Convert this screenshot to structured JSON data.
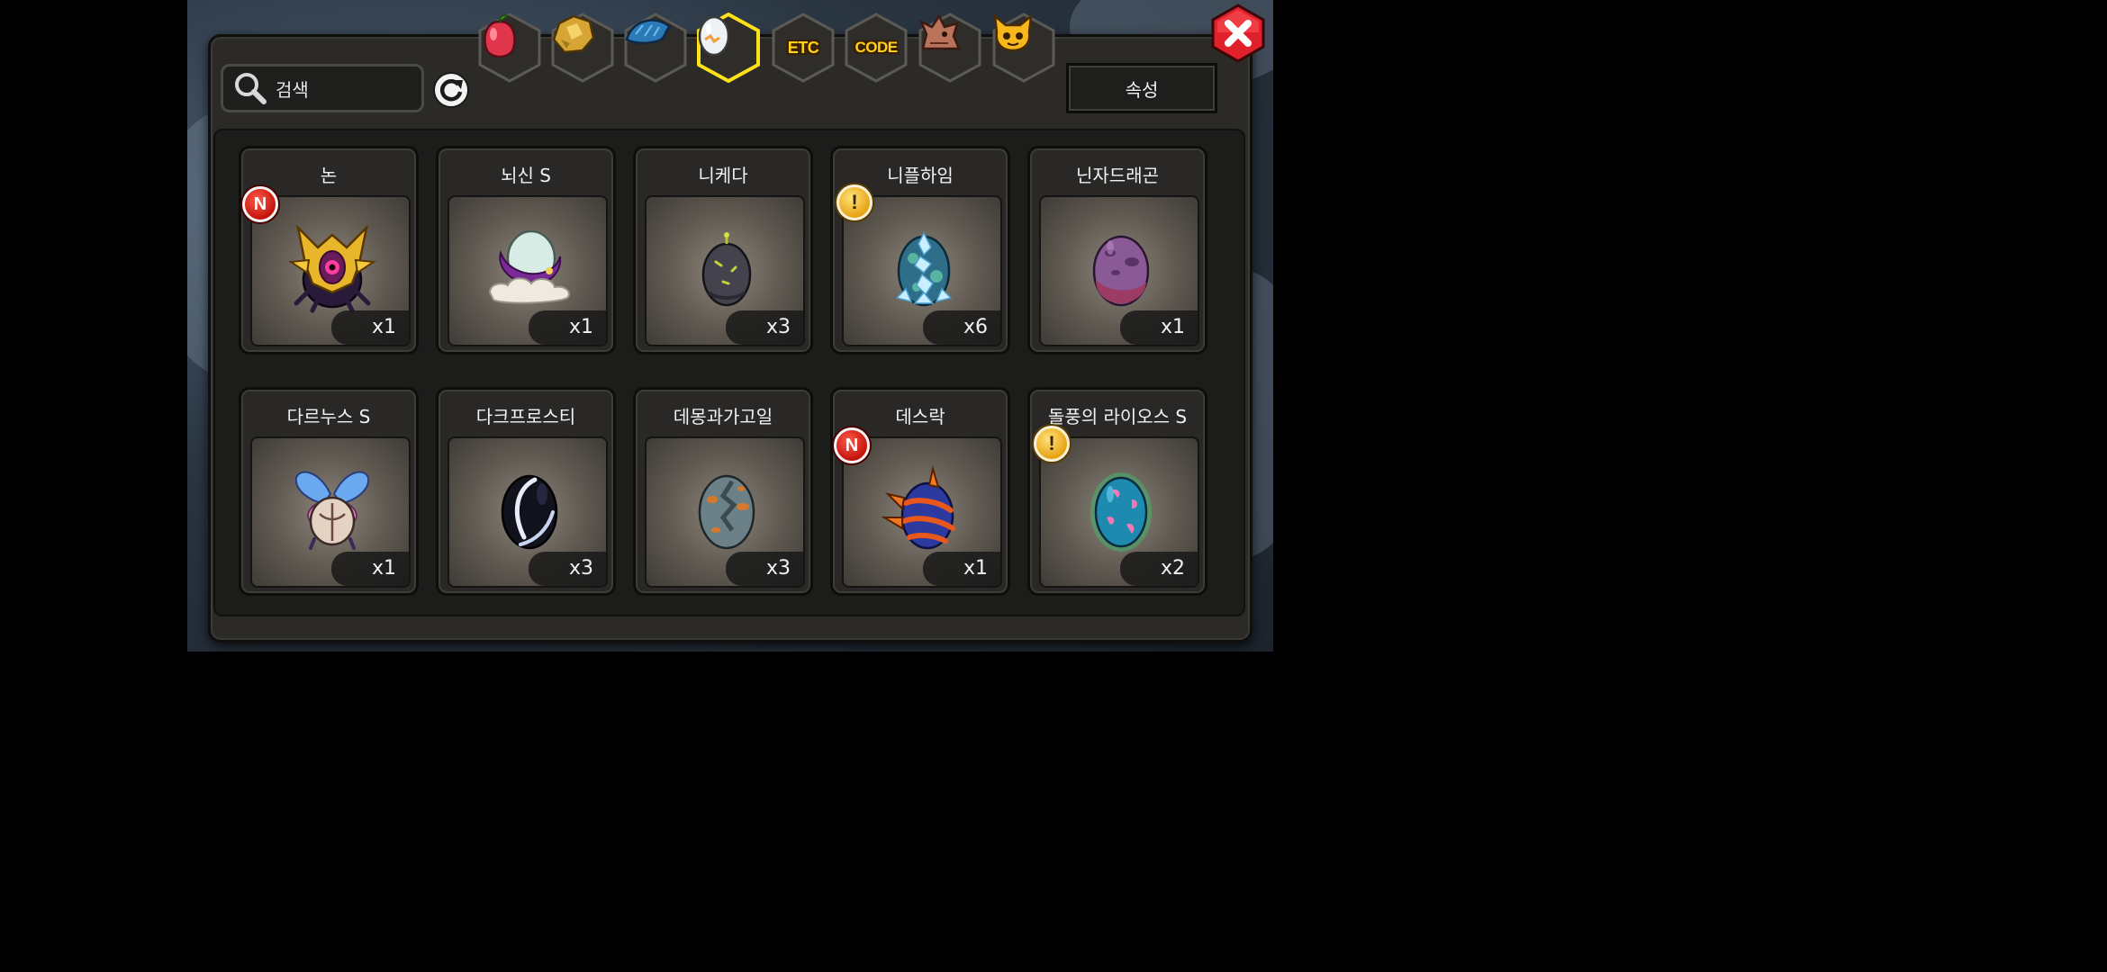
{
  "tabs": [
    {
      "name": "fruit",
      "icon": "red-fruit-icon",
      "label": ""
    },
    {
      "name": "gold",
      "icon": "gold-ore-icon",
      "label": ""
    },
    {
      "name": "wing",
      "icon": "blue-wing-icon",
      "label": ""
    },
    {
      "name": "egg",
      "icon": "egg-icon",
      "label": "",
      "selected": true
    },
    {
      "name": "etc",
      "icon": "text-tab",
      "label": "ETC"
    },
    {
      "name": "code",
      "icon": "text-tab",
      "label": "CODE"
    },
    {
      "name": "dragon",
      "icon": "dragon-head-icon",
      "label": ""
    },
    {
      "name": "mascot",
      "icon": "yellow-mascot-icon",
      "label": ""
    }
  ],
  "search": {
    "label": "검색"
  },
  "attribute_button": {
    "label": "속성"
  },
  "items": [
    {
      "name": "논",
      "count": "x1",
      "badge": "N",
      "egg": "gold-horned-egg"
    },
    {
      "name": "뇌신 S",
      "count": "x1",
      "badge": "",
      "egg": "cloud-egg"
    },
    {
      "name": "니케다",
      "count": "x3",
      "badge": "",
      "egg": "dark-gray-egg"
    },
    {
      "name": "니플하임",
      "count": "x6",
      "badge": "!",
      "egg": "ice-crystal-egg"
    },
    {
      "name": "닌자드래곤",
      "count": "x1",
      "badge": "",
      "egg": "purple-spotted-egg"
    },
    {
      "name": "다르누스 S",
      "count": "x1",
      "badge": "",
      "egg": "butterfly-wing-egg"
    },
    {
      "name": "다크프로스티",
      "count": "x3",
      "badge": "",
      "egg": "black-swirl-egg"
    },
    {
      "name": "데몽과가고일",
      "count": "x3",
      "badge": "",
      "egg": "gray-orange-egg"
    },
    {
      "name": "데스락",
      "count": "x1",
      "badge": "N",
      "egg": "blue-spiked-egg"
    },
    {
      "name": "돌풍의 라이오스 S",
      "count": "x2",
      "badge": "!",
      "egg": "teal-pink-egg"
    }
  ],
  "colors": {
    "panel": "#2b2a27",
    "selected_tab_ring": "#ffe11a",
    "new_badge": "#d8180e",
    "alert_badge": "#f2b42a",
    "close_button": "#e0202a"
  }
}
